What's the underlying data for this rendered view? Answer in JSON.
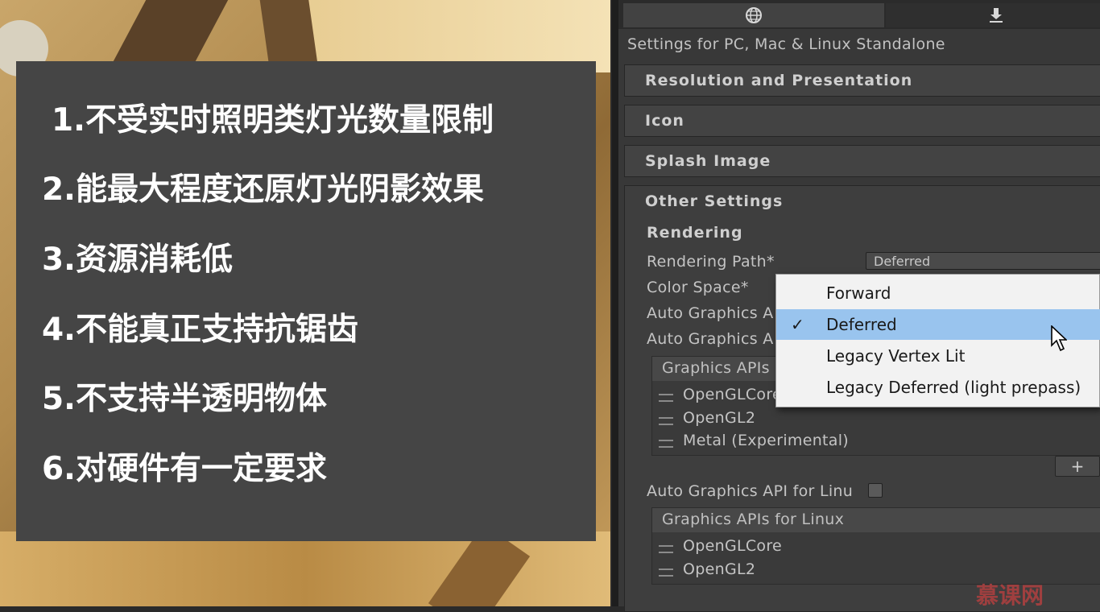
{
  "slide": {
    "lines": [
      "1.不受实时照明类灯光数量限制",
      "2.能最大程度还原灯光阴影效果",
      "3.资源消耗低",
      "4.不能真正支持抗锯齿",
      "5.不支持半透明物体",
      "6.对硬件有一定要求"
    ]
  },
  "inspector": {
    "tabs": {
      "web_icon": "globe-icon",
      "download_icon": "download-icon"
    },
    "settings_for": "Settings for PC, Mac & Linux Standalone",
    "sections": {
      "resolution": "Resolution and Presentation",
      "icon": "Icon",
      "splash": "Splash Image",
      "other": "Other Settings"
    },
    "rendering": {
      "heading": "Rendering",
      "path_label": "Rendering Path*",
      "path_value": "Deferred",
      "color_space_label": "Color Space*",
      "auto_api_1": "Auto Graphics A",
      "auto_api_2": "Auto Graphics A",
      "graphics_apis_header_1": "Graphics APIs",
      "apis_1": [
        "OpenGLCore",
        "OpenGL2",
        "Metal (Experimental)"
      ],
      "plus": "+",
      "auto_api_linux": "Auto Graphics API for Linu",
      "graphics_apis_header_linux": "Graphics APIs for Linux",
      "apis_linux": [
        "OpenGLCore",
        "OpenGL2"
      ]
    }
  },
  "popup": {
    "items": [
      "Forward",
      "Deferred",
      "Legacy Vertex Lit",
      "Legacy Deferred (light prepass)"
    ],
    "selected": "Deferred",
    "check": "✓"
  },
  "watermark": "慕课网",
  "colors": {
    "selected_bg": "#99c4ee",
    "panel": "#383838",
    "slide": "#454545"
  }
}
